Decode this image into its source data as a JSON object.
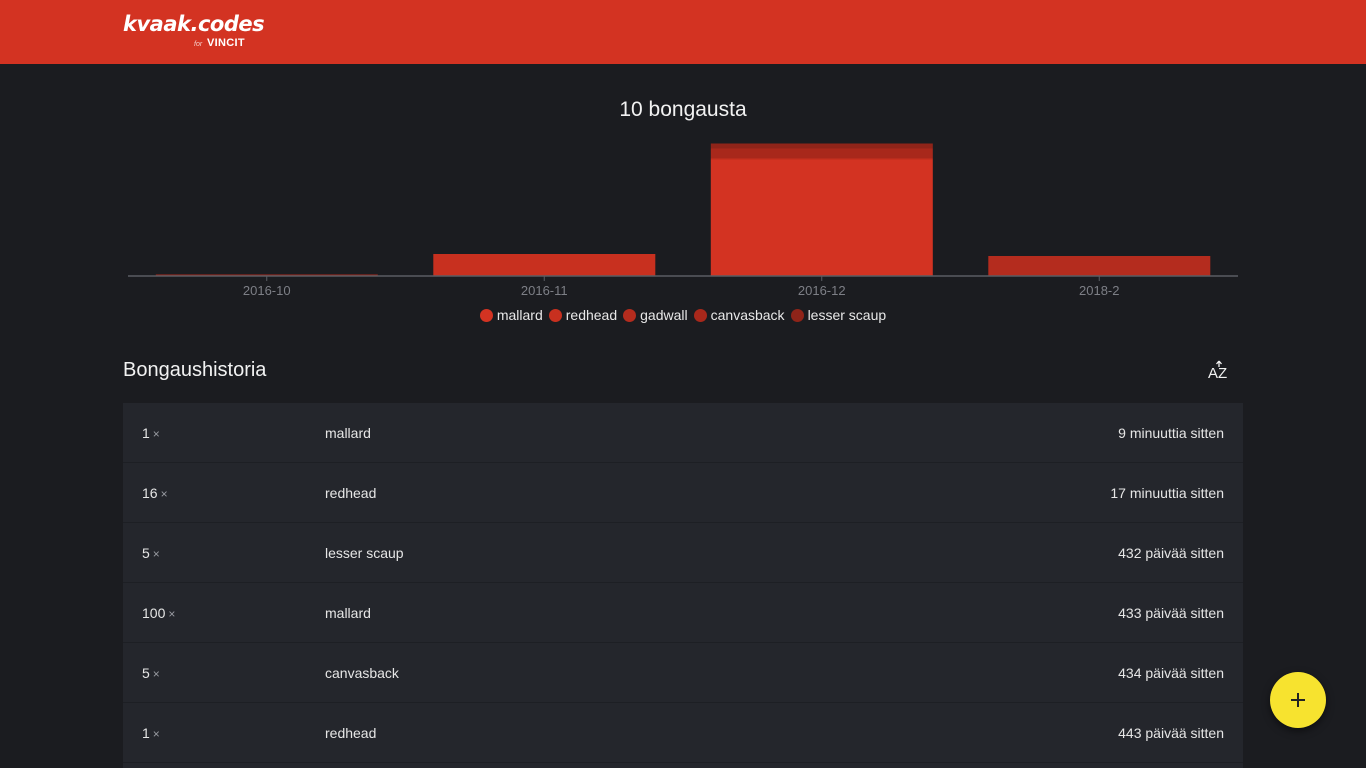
{
  "header": {
    "logo_main": "kvaak.codes",
    "logo_for": "for",
    "logo_brand": "VINCIT",
    "brand_color": "#d33322"
  },
  "summary": {
    "title": "10 bongausta"
  },
  "chart_data": {
    "type": "bar",
    "stacked": true,
    "categories": [
      "2016-10",
      "2016-11",
      "2016-12",
      "2018-2"
    ],
    "series": [
      {
        "name": "mallard",
        "color": "#d33322",
        "values": [
          0,
          0,
          116,
          0
        ]
      },
      {
        "name": "redhead",
        "color": "#c8301f",
        "values": [
          0,
          22,
          1,
          0
        ]
      },
      {
        "name": "gadwall",
        "color": "#b42c1e",
        "values": [
          0,
          0,
          0,
          20
        ]
      },
      {
        "name": "canvasback",
        "color": "#a8281b",
        "values": [
          1,
          0,
          10,
          0
        ]
      },
      {
        "name": "lesser scaup",
        "color": "#8f2419",
        "values": [
          0,
          0,
          5,
          0
        ]
      }
    ],
    "ylim": [
      0,
      132
    ],
    "grid": false,
    "legend_position": "bottom"
  },
  "history": {
    "title": "Bongaushistoria",
    "sort_icon": "sort-alpha-icon",
    "times_symbol": "×",
    "rows": [
      {
        "count": "1",
        "species": "mallard",
        "time": "9 minuuttia sitten"
      },
      {
        "count": "16",
        "species": "redhead",
        "time": "17 minuuttia sitten"
      },
      {
        "count": "5",
        "species": "lesser scaup",
        "time": "432 päivää sitten"
      },
      {
        "count": "100",
        "species": "mallard",
        "time": "433 päivää sitten"
      },
      {
        "count": "5",
        "species": "canvasback",
        "time": "434 päivää sitten"
      },
      {
        "count": "1",
        "species": "redhead",
        "time": "443 päivää sitten"
      }
    ]
  },
  "fab": {
    "icon": "plus-icon",
    "color": "#f7e32f"
  }
}
